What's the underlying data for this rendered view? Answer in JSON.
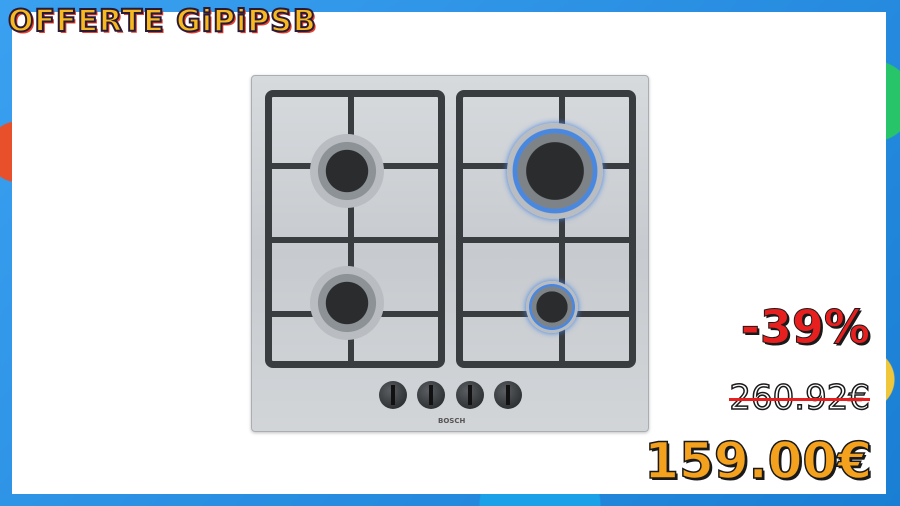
{
  "brand": {
    "title": "OFFERTE GiPiPSB"
  },
  "product": {
    "logo_text": "BOSCH",
    "discount": "-39%",
    "old_price": "260.92€",
    "new_price": "159.00€"
  },
  "colors": {
    "accent": "#f4a11e",
    "discount": "#e81f1f",
    "frame": "#2b8fe0"
  }
}
